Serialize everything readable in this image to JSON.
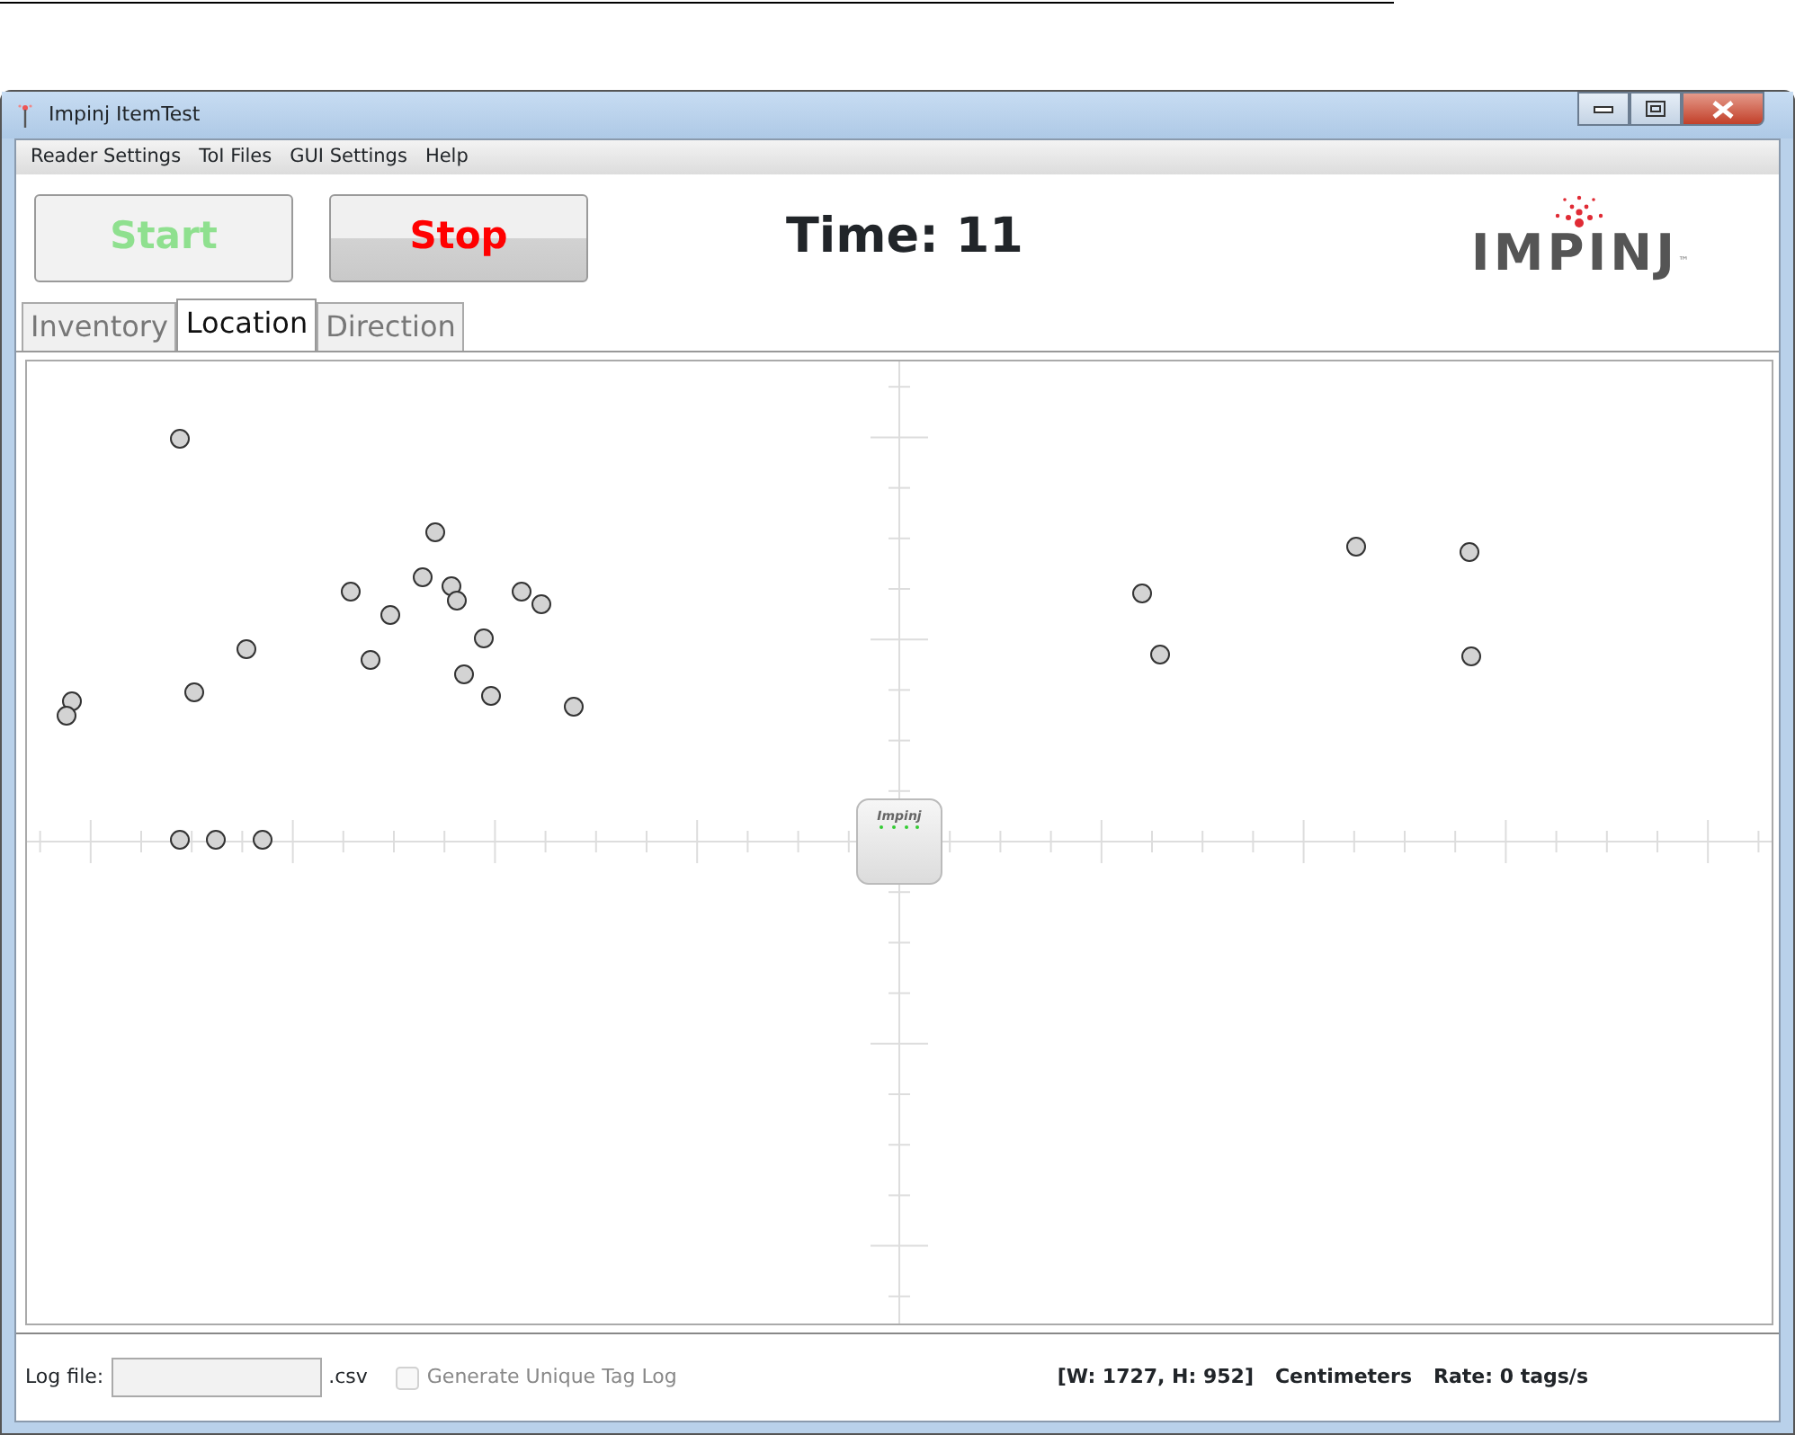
{
  "window": {
    "title": "Impinj ItemTest"
  },
  "menu": [
    {
      "label": "Reader Settings"
    },
    {
      "label": "ToI Files"
    },
    {
      "label": "GUI Settings"
    },
    {
      "label": "Help"
    }
  ],
  "toolbar": {
    "start": {
      "label": "Start",
      "disabled": true
    },
    "stop": {
      "label": "Stop",
      "disabled": false
    },
    "time": "Time: 11",
    "logo": {
      "text": "IMPINJ",
      "mark": "™"
    }
  },
  "tabs": [
    {
      "label": "Inventory",
      "selected": false
    },
    {
      "label": "Location",
      "selected": true
    },
    {
      "label": "Direction",
      "selected": false
    }
  ],
  "location_view": {
    "reader_label": "Impinj"
  },
  "footer": {
    "log_label": "Log file:",
    "log_ext": ".csv",
    "unique_log": {
      "label": "Generate Unique Tag Log",
      "checked": false,
      "disabled": true
    },
    "dimensions": "[W: 1727, H: 952]",
    "units": "Centimeters",
    "rate": "Rate: 0 tags/s"
  }
}
